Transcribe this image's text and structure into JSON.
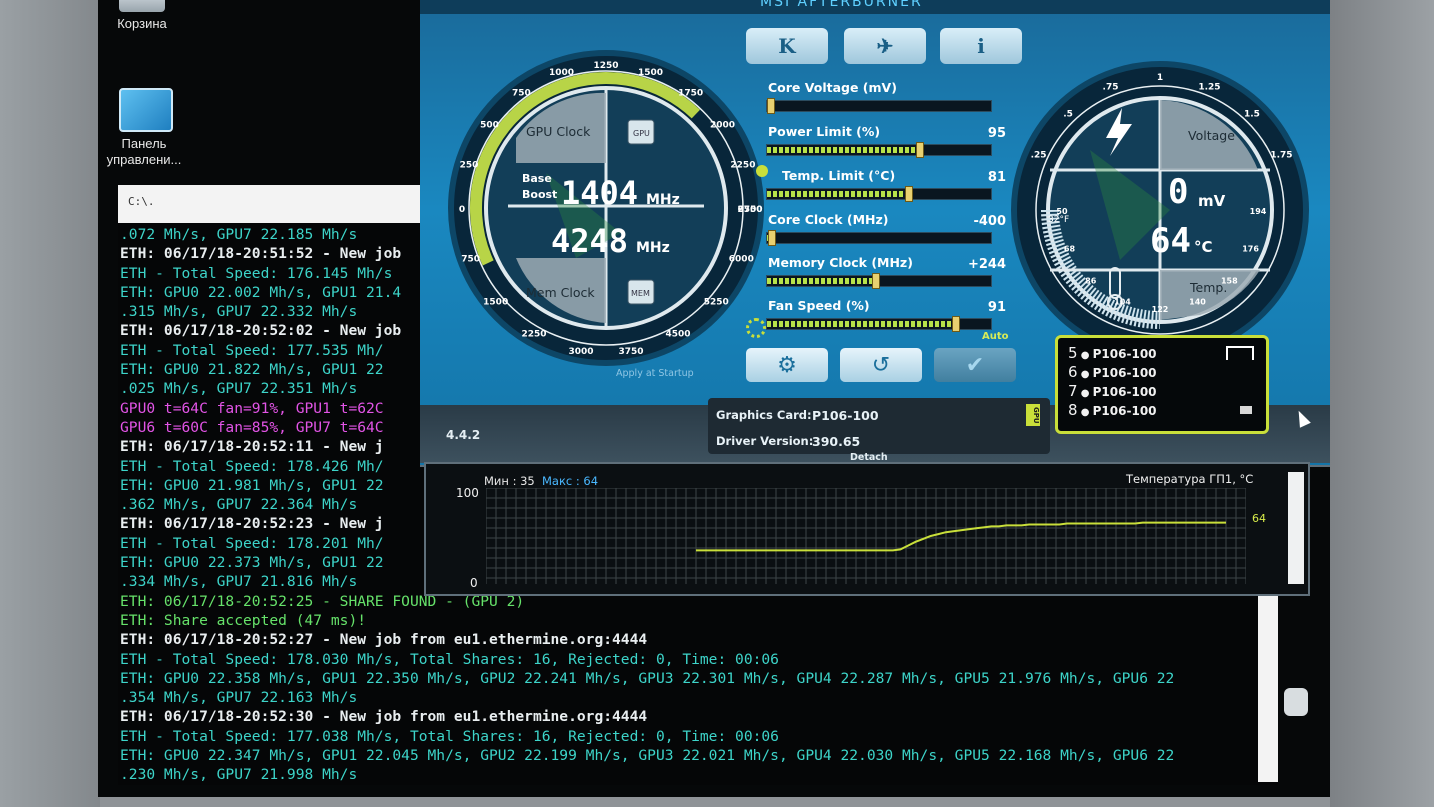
{
  "desktop": {
    "icons": [
      {
        "label": "Корзина"
      },
      {
        "label": "Панель управлени..."
      }
    ]
  },
  "console": {
    "title_glyph": "C:\\.",
    "lines": [
      {
        "text": ".072 Mh/s, GPU7 22.185 Mh/s",
        "color": "cyan"
      },
      {
        "text": "ETH: 06/17/18-20:51:52 - New job",
        "color": "white"
      },
      {
        "text": "ETH - Total Speed: 176.145 Mh/s",
        "color": "cyan"
      },
      {
        "text": "ETH: GPU0 22.002 Mh/s, GPU1 21.4",
        "color": "cyan"
      },
      {
        "text": ".315 Mh/s, GPU7 22.332 Mh/s",
        "color": "cyan"
      },
      {
        "text": "ETH: 06/17/18-20:52:02 - New job",
        "color": "white"
      },
      {
        "text": "ETH - Total Speed: 177.535 Mh/",
        "color": "cyan"
      },
      {
        "text": "ETH: GPU0 21.822 Mh/s, GPU1 22",
        "color": "cyan"
      },
      {
        "text": ".025 Mh/s, GPU7 22.351 Mh/s",
        "color": "cyan"
      },
      {
        "text": "GPU0 t=64C fan=91%, GPU1 t=62C",
        "color": "magenta"
      },
      {
        "text": "GPU6 t=60C fan=85%, GPU7 t=64C",
        "color": "magenta"
      },
      {
        "text": "ETH: 06/17/18-20:52:11 - New j",
        "color": "white"
      },
      {
        "text": "ETH - Total Speed: 178.426 Mh/",
        "color": "cyan"
      },
      {
        "text": "ETH: GPU0 21.981 Mh/s, GPU1 22",
        "color": "cyan"
      },
      {
        "text": ".362 Mh/s, GPU7 22.364 Mh/s",
        "color": "cyan"
      },
      {
        "text": "ETH: 06/17/18-20:52:23 - New j",
        "color": "white"
      },
      {
        "text": "ETH - Total Speed: 178.201 Mh/",
        "color": "cyan"
      },
      {
        "text": "ETH: GPU0 22.373 Mh/s, GPU1 22",
        "color": "cyan"
      },
      {
        "text": ".334 Mh/s, GPU7 21.816 Mh/s",
        "color": "cyan"
      },
      {
        "text": "ETH: 06/17/18-20:52:25 - SHARE FOUND - (GPU 2)",
        "color": "green"
      },
      {
        "text": "ETH: Share accepted (47 ms)!",
        "color": "green"
      },
      {
        "text": "ETH: 06/17/18-20:52:27 - New job from eu1.ethermine.org:4444",
        "color": "white"
      },
      {
        "text": "ETH - Total Speed: 178.030 Mh/s, Total Shares: 16, Rejected: 0, Time: 00:06",
        "color": "cyan"
      },
      {
        "text": "ETH: GPU0 22.358 Mh/s, GPU1 22.350 Mh/s, GPU2 22.241 Mh/s, GPU3 22.301 Mh/s, GPU4 22.287 Mh/s, GPU5 21.976 Mh/s, GPU6 22",
        "color": "cyan"
      },
      {
        "text": ".354 Mh/s, GPU7 22.163 Mh/s",
        "color": "cyan"
      },
      {
        "text": "ETH: 06/17/18-20:52:30 - New job from eu1.ethermine.org:4444",
        "color": "white"
      },
      {
        "text": "ETH - Total Speed: 177.038 Mh/s, Total Shares: 16, Rejected: 0, Time: 00:06",
        "color": "cyan"
      },
      {
        "text": "ETH: GPU0 22.347 Mh/s, GPU1 22.045 Mh/s, GPU2 22.199 Mh/s, GPU3 22.021 Mh/s, GPU4 22.030 Mh/s, GPU5 22.168 Mh/s, GPU6 22",
        "color": "cyan"
      },
      {
        "text": ".230 Mh/s, GPU7 21.998 Mh/s",
        "color": "cyan"
      }
    ]
  },
  "afterburner": {
    "title": "MSI AFTERBURNER",
    "top_buttons": [
      "K",
      "✈",
      "i"
    ],
    "left_gauge": {
      "top_label": "GPU Clock",
      "bottom_label": "Mem Clock",
      "gpu_chip": "GPU",
      "mem_chip": "MEM",
      "base_label": "Base",
      "boost_label": "Boost",
      "gpu_clock_value": "1404",
      "gpu_clock_unit": "MHz",
      "mem_clock_value": "4248",
      "mem_clock_unit": "MHz",
      "scale": [
        "0",
        "250",
        "500",
        "750",
        "1000",
        "1250",
        "1500",
        "1750",
        "2000",
        "2250",
        "2500"
      ],
      "mem_scale": [
        "750",
        "1500",
        "2250",
        "3000",
        "3750",
        "4500",
        "5250",
        "6000",
        "6750"
      ]
    },
    "right_gauge": {
      "top_label": "Voltage",
      "bottom_label": "Temp.",
      "voltage_value": "0",
      "voltage_unit": "mV",
      "temp_value": "64",
      "temp_unit": "°C",
      "fahrenheit": "32°F",
      "scale": [
        ".25",
        ".5",
        ".75",
        "1",
        "1.25",
        "1.5",
        "1.75"
      ],
      "temp_scale": [
        "50",
        "68",
        "86",
        "104",
        "122",
        "140",
        "158",
        "176",
        "194"
      ]
    },
    "sliders": [
      {
        "label": "Core Voltage (mV)",
        "value": "",
        "level": 0.0
      },
      {
        "label": "Power Limit (%)",
        "value": "95",
        "level": 0.68
      },
      {
        "label": "Temp. Limit (°C)",
        "value": "81",
        "level": 0.63
      },
      {
        "label": "Core Clock (MHz)",
        "value": "-400",
        "level": 0.02
      },
      {
        "label": "Memory Clock (MHz)",
        "value": "+244",
        "level": 0.48
      },
      {
        "label": "Fan Speed (%)",
        "value": "91",
        "level": 0.84
      }
    ],
    "fan_auto": "Auto",
    "apply_at_startup": "Apply at Startup",
    "bottom_buttons": [
      "⚙",
      "↺",
      "✔"
    ],
    "version": "4.4.2",
    "graphics_card_label": "Graphics Card:",
    "graphics_card_value": "P106-100",
    "driver_label": "Driver Version:",
    "driver_value": "390.65",
    "detach": "Detach",
    "gpu_tab": "GPU",
    "gpu_list": [
      {
        "num": "5",
        "name": "P106-100"
      },
      {
        "num": "6",
        "name": "P106-100"
      },
      {
        "num": "7",
        "name": "P106-100"
      },
      {
        "num": "8",
        "name": "P106-100"
      }
    ]
  },
  "graph": {
    "min_label": "Мин : 35",
    "max_label": "Макс : 64",
    "title": "Температура ГП1, °C",
    "y_top": "100",
    "y_bottom": "0",
    "current": "64",
    "series": [
      35,
      35,
      35,
      35,
      35,
      35,
      35,
      35,
      35,
      35,
      35,
      35,
      35,
      35,
      35,
      35,
      35,
      35,
      35,
      35,
      35,
      35,
      35,
      35,
      35,
      35,
      35,
      36,
      40,
      44,
      47,
      50,
      52,
      54,
      55,
      56,
      57,
      58,
      59,
      60,
      60,
      61,
      61,
      61,
      62,
      62,
      62,
      62,
      62,
      63,
      63,
      63,
      63,
      63,
      63,
      63,
      63,
      63,
      63,
      64,
      64,
      64,
      64,
      64,
      64,
      64,
      64,
      64,
      64,
      64,
      64
    ]
  },
  "colors": {
    "accent_yellow": "#c9df3a",
    "console_cyan": "#3dd4c9",
    "console_magenta": "#e254e6",
    "console_green": "#66e26a",
    "ab_blue": "#1a88c0"
  }
}
